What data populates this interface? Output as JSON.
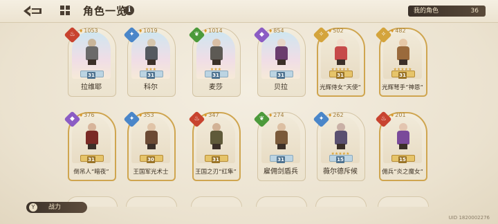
{
  "header": {
    "title": "角色一览",
    "my_characters_label": "我的角色",
    "my_characters_count": "36"
  },
  "colors": {
    "fire": "#c8432f",
    "water": "#4a86c9",
    "nature": "#4c9a3b",
    "dark": "#8b5cc4"
  },
  "characters": [
    {
      "name": "拉维耶",
      "power": "1053",
      "level": "31",
      "element": "fire-element-icon",
      "stars": "",
      "gold": false
    },
    {
      "name": "科尔",
      "power": "1019",
      "level": "31",
      "element": "water-element-icon",
      "stars": "★★★",
      "gold": false
    },
    {
      "name": "麦莎",
      "power": "1014",
      "level": "31",
      "element": "nature-element-icon",
      "stars": "★★★",
      "gold": false
    },
    {
      "name": "贝拉",
      "power": "854",
      "level": "31",
      "element": "dark-element-icon",
      "stars": "",
      "gold": false
    },
    {
      "name": "光辉侍女“天使”",
      "power": "502",
      "level": "31",
      "element": "",
      "stars": "★★★★★",
      "gold": true
    },
    {
      "name": "光辉弩手“神恩”",
      "power": "482",
      "level": "31",
      "element": "",
      "stars": "★★★★★",
      "gold": true
    },
    {
      "name": "倒吊人“暗夜”",
      "power": "376",
      "level": "31",
      "element": "dark-element-icon",
      "stars": "",
      "gold": true
    },
    {
      "name": "王国军光术士",
      "power": "353",
      "level": "30",
      "element": "water-element-icon",
      "stars": "",
      "gold": true
    },
    {
      "name": "王国之刃“红隼”",
      "power": "347",
      "level": "31",
      "element": "fire-element-icon",
      "stars": "",
      "gold": true
    },
    {
      "name": "雇佣剑盾兵",
      "power": "274",
      "level": "31",
      "element": "nature-element-icon",
      "stars": "",
      "gold": false
    },
    {
      "name": "薇尔德斥候",
      "power": "262",
      "level": "15",
      "element": "water-element-icon",
      "stars": "★★★★★",
      "gold": false
    },
    {
      "name": "佣兵“炎之魔女”",
      "power": "201",
      "level": "15",
      "element": "fire-element-icon",
      "stars": "",
      "gold": true
    }
  ],
  "footer": {
    "power_label": "战力",
    "power_icon": "sort-icon",
    "uid": "UID 1820002276"
  }
}
